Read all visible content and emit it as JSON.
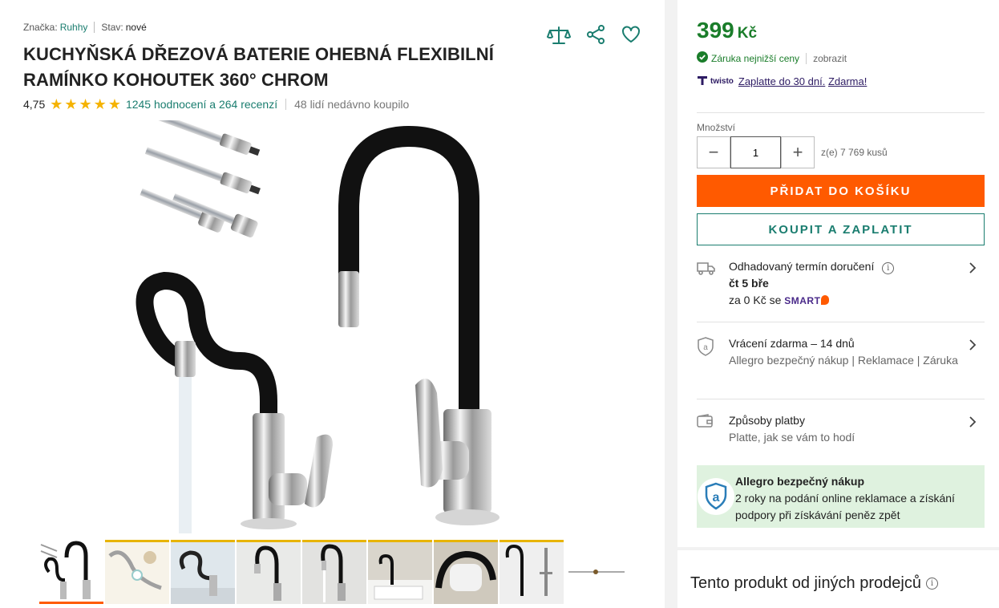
{
  "product": {
    "brand_label": "Značka:",
    "brand_value": "Ruhhy",
    "condition_label": "Stav:",
    "condition_value": "nové",
    "title": "KUCHYŇSKÁ DŘEZOVÁ BATERIE OHEBNÁ FLEXIBILNÍ RAMÍNKO KOHOUTEK 360° CHROM",
    "rating": "4,75",
    "stars": 5,
    "reviews_link": "1245 hodnocení a 264 recenzí",
    "recent_buyers": "48 lidí nedávno koupilo"
  },
  "actions": {
    "compare_icon": "scales-icon",
    "share_icon": "share-icon",
    "favorite_icon": "heart-icon"
  },
  "gallery": {
    "thumbnail_count": 8
  },
  "offer": {
    "price": "399",
    "currency": "Kč",
    "guarantee": "Záruka nejnižší ceny",
    "guarantee_show": "zobrazit",
    "twisto_name": "twisto",
    "twisto_pay_later": "Zaplatte do 30 dní.",
    "twisto_free": "Zdarma!",
    "quantity_label": "Množství",
    "quantity_value": "1",
    "stock": "z(e) 7 769 kusů",
    "add_to_cart": "PŘIDAT DO KOŠÍKU",
    "buy_now": "KOUPIT A ZAPLATIT"
  },
  "delivery": {
    "label": "Odhadovaný termín doručení",
    "date": "čt 5 bře",
    "price_prefix": "za 0 Kč se",
    "smart": "SMART"
  },
  "returns": {
    "label": "Vrácení zdarma – 14 dnů",
    "sub": "Allegro bezpečný nákup | Reklamace | Záruka"
  },
  "payment": {
    "label": "Způsoby platby",
    "sub": "Platte, jak se vám to hodí"
  },
  "safe_purchase": {
    "title": "Allegro bezpečný nákup",
    "text": "2 roky na podání online reklamace a získání podpory při získávání peněz zpět"
  },
  "other_sellers": {
    "title": "Tento produkt od jiných prodejců"
  },
  "colors": {
    "accent_orange": "#ff5a00",
    "teal": "#1a7d6f",
    "price_green": "#1a7d2a",
    "safe_bg": "#dff2df"
  }
}
